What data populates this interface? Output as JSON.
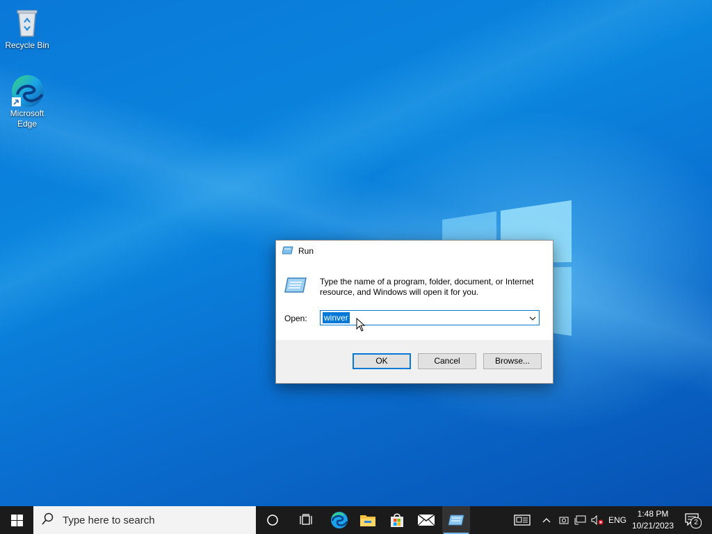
{
  "desktop": {
    "icons": [
      {
        "label": "Recycle Bin",
        "icon": "recycle-bin-icon"
      },
      {
        "label": "Microsoft Edge",
        "icon": "edge-icon"
      }
    ]
  },
  "run_dialog": {
    "title": "Run",
    "description": "Type the name of a program, folder, document, or Internet resource, and Windows will open it for you.",
    "open_label": "Open:",
    "open_value": "winver",
    "ok_label": "OK",
    "cancel_label": "Cancel",
    "browse_label": "Browse..."
  },
  "taskbar": {
    "search_placeholder": "Type here to search",
    "pinned": [
      "start-icon",
      "cortana-icon",
      "task-view-icon",
      "edge-icon",
      "file-explorer-icon",
      "store-icon",
      "mail-icon",
      "run-app-icon"
    ],
    "tray": {
      "language": "ENG",
      "time": "1:48 PM",
      "date": "10/21/2023",
      "notification_count": "2"
    }
  },
  "colors": {
    "accent": "#0078d7",
    "taskbar": "#1b1b1b",
    "desktop": "#0a78d8"
  }
}
